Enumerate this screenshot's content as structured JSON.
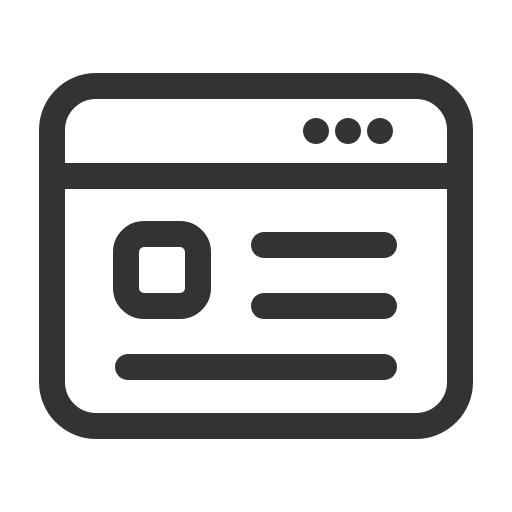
{
  "icon": {
    "name": "browser-window-content-icon",
    "stroke_color": "#333333",
    "background": "#ffffff",
    "title_bar_dots": 3
  }
}
